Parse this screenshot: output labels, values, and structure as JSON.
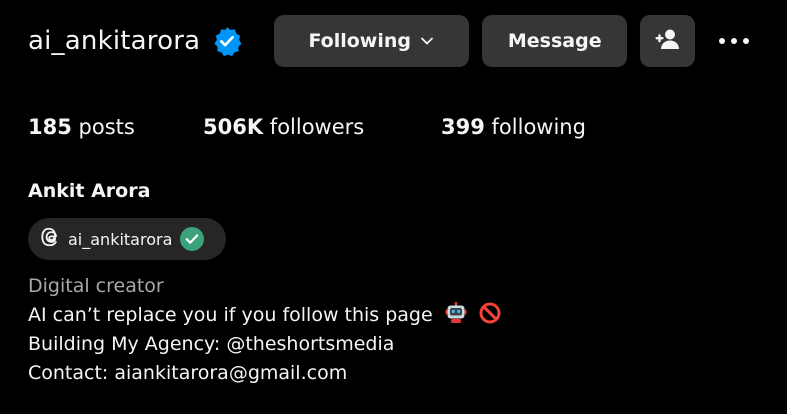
{
  "profile": {
    "username": "ai_ankitarora",
    "full_name": "Ankit Arora",
    "verified": true
  },
  "buttons": {
    "following_label": "Following",
    "message_label": "Message"
  },
  "stats": {
    "posts_count": "185",
    "posts_label": "posts",
    "followers_count": "506K",
    "followers_label": "followers",
    "following_count": "399",
    "following_label": "following"
  },
  "threads": {
    "handle": "ai_ankitarora"
  },
  "bio": {
    "category": "Digital creator",
    "line1": "AI can’t replace you if you follow this page",
    "line2": "Building My Agency: @theshortsmedia",
    "line3": "Contact: aiankitarora@gmail.com"
  },
  "colors": {
    "verified_blue": "#0095f6",
    "threads_check_green": "#3aa37c",
    "button_bg": "#363636",
    "pill_bg": "#262626",
    "category_gray": "#a8a8a8"
  },
  "icons": [
    "verified-badge-icon",
    "chevron-down-icon",
    "add-user-icon",
    "more-options-icon",
    "threads-logo-icon",
    "check-icon",
    "robot-emoji-icon",
    "prohibited-emoji-icon"
  ]
}
